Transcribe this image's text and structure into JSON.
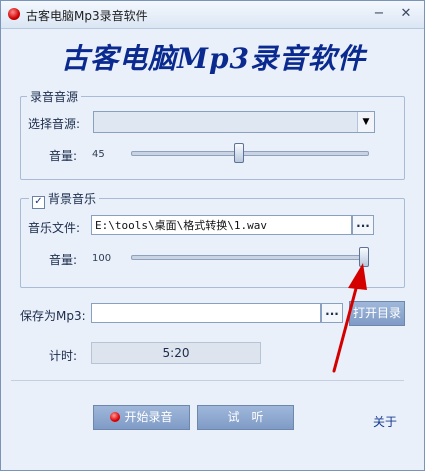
{
  "window": {
    "title": "古客电脑Mp3录音软件",
    "minimize_glyph": "−",
    "close_glyph": "✕"
  },
  "app_title": "古客电脑Mp3录音软件",
  "recording_source": {
    "group_label": "录音音源",
    "select_label": "选择音源:",
    "select_value": "",
    "volume_label": "音量:",
    "volume_value": "45",
    "volume_fraction": 0.45
  },
  "background_music": {
    "checkbox_label": "背景音乐",
    "checked": true,
    "file_label": "音乐文件:",
    "file_value": "E:\\tools\\桌面\\格式转换\\1.wav",
    "browse_label": "...",
    "volume_label": "音量:",
    "volume_value": "100",
    "volume_fraction": 1.0
  },
  "save": {
    "label": "保存为Mp3:",
    "value": "",
    "browse_label": "...",
    "open_dir_label": "打开目录"
  },
  "timer": {
    "label": "计时:",
    "value": "5:20"
  },
  "actions": {
    "start_label": "开始录音",
    "listen_label": "试　听",
    "about_label": "关于"
  },
  "icons": [
    "app-record-icon",
    "minimize-icon",
    "close-icon",
    "dropdown-arrow-icon",
    "record-dot-icon",
    "red-arrow-annotation"
  ],
  "colors": {
    "title_blue": "#0a2a8f",
    "button_blue": "#8aa6cf",
    "window_bg": "#e9f0fa",
    "annotation_red": "#d40000"
  }
}
